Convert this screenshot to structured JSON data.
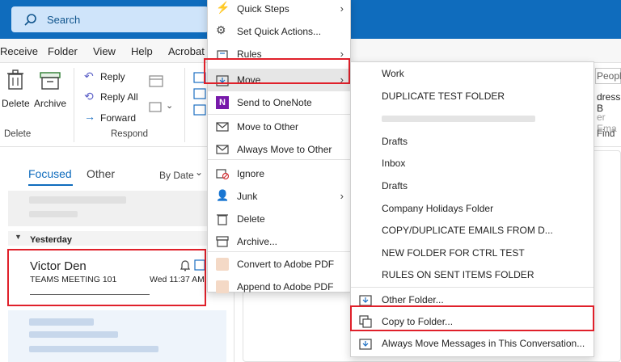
{
  "search": {
    "placeholder": "Search"
  },
  "ribbon_tabs": [
    "Receive",
    "Folder",
    "View",
    "Help",
    "Acrobat"
  ],
  "ribbon": {
    "delete": "Delete",
    "archive": "Archive",
    "reply": "Reply",
    "reply_all": "Reply All",
    "forward": "Forward",
    "group_delete": "Delete",
    "group_respond": "Respond",
    "people_partial": "People",
    "address_partial": "dress B",
    "filter_partial": "er Ema",
    "find": "Find"
  },
  "list": {
    "focused": "Focused",
    "other": "Other",
    "sort": "By Date",
    "sort_arrow": "⌄",
    "group_yesterday": "Yesterday",
    "selected_sender": "Victor Den",
    "selected_subject": "TEAMS MEETING 101",
    "selected_date": "Wed 11:37 AM"
  },
  "context_menu": {
    "items": [
      {
        "label": "Quick Steps",
        "arrow": true
      },
      {
        "label": "Set Quick Actions...",
        "arrow": false
      },
      {
        "label": "Rules",
        "arrow": true
      },
      {
        "label": "Move",
        "arrow": true
      },
      {
        "label": "Send to OneNote",
        "arrow": false
      },
      {
        "label": "Move to Other",
        "arrow": false
      },
      {
        "label": "Always Move to Other",
        "arrow": false
      },
      {
        "label": "Ignore",
        "arrow": false
      },
      {
        "label": "Junk",
        "arrow": true
      },
      {
        "label": "Delete",
        "arrow": false
      },
      {
        "label": "Archive...",
        "arrow": false
      },
      {
        "label": "Convert to Adobe PDF",
        "arrow": false
      },
      {
        "label": "Append to Adobe PDF",
        "arrow": false
      }
    ]
  },
  "move_submenu": {
    "folders": [
      "Work",
      "DUPLICATE TEST FOLDER",
      "",
      "Drafts",
      "Inbox",
      "Drafts",
      "Company Holidays Folder",
      "COPY/DUPLICATE EMAILS FROM D...",
      "NEW FOLDER FOR CTRL TEST",
      "RULES ON SENT ITEMS FOLDER"
    ],
    "other_folder": "Other Folder...",
    "copy_to_folder": "Copy to Folder...",
    "always_move": "Always Move Messages in This Conversation..."
  },
  "colors": {
    "brand": "#0f6cbd",
    "highlight": "#e0202a"
  }
}
